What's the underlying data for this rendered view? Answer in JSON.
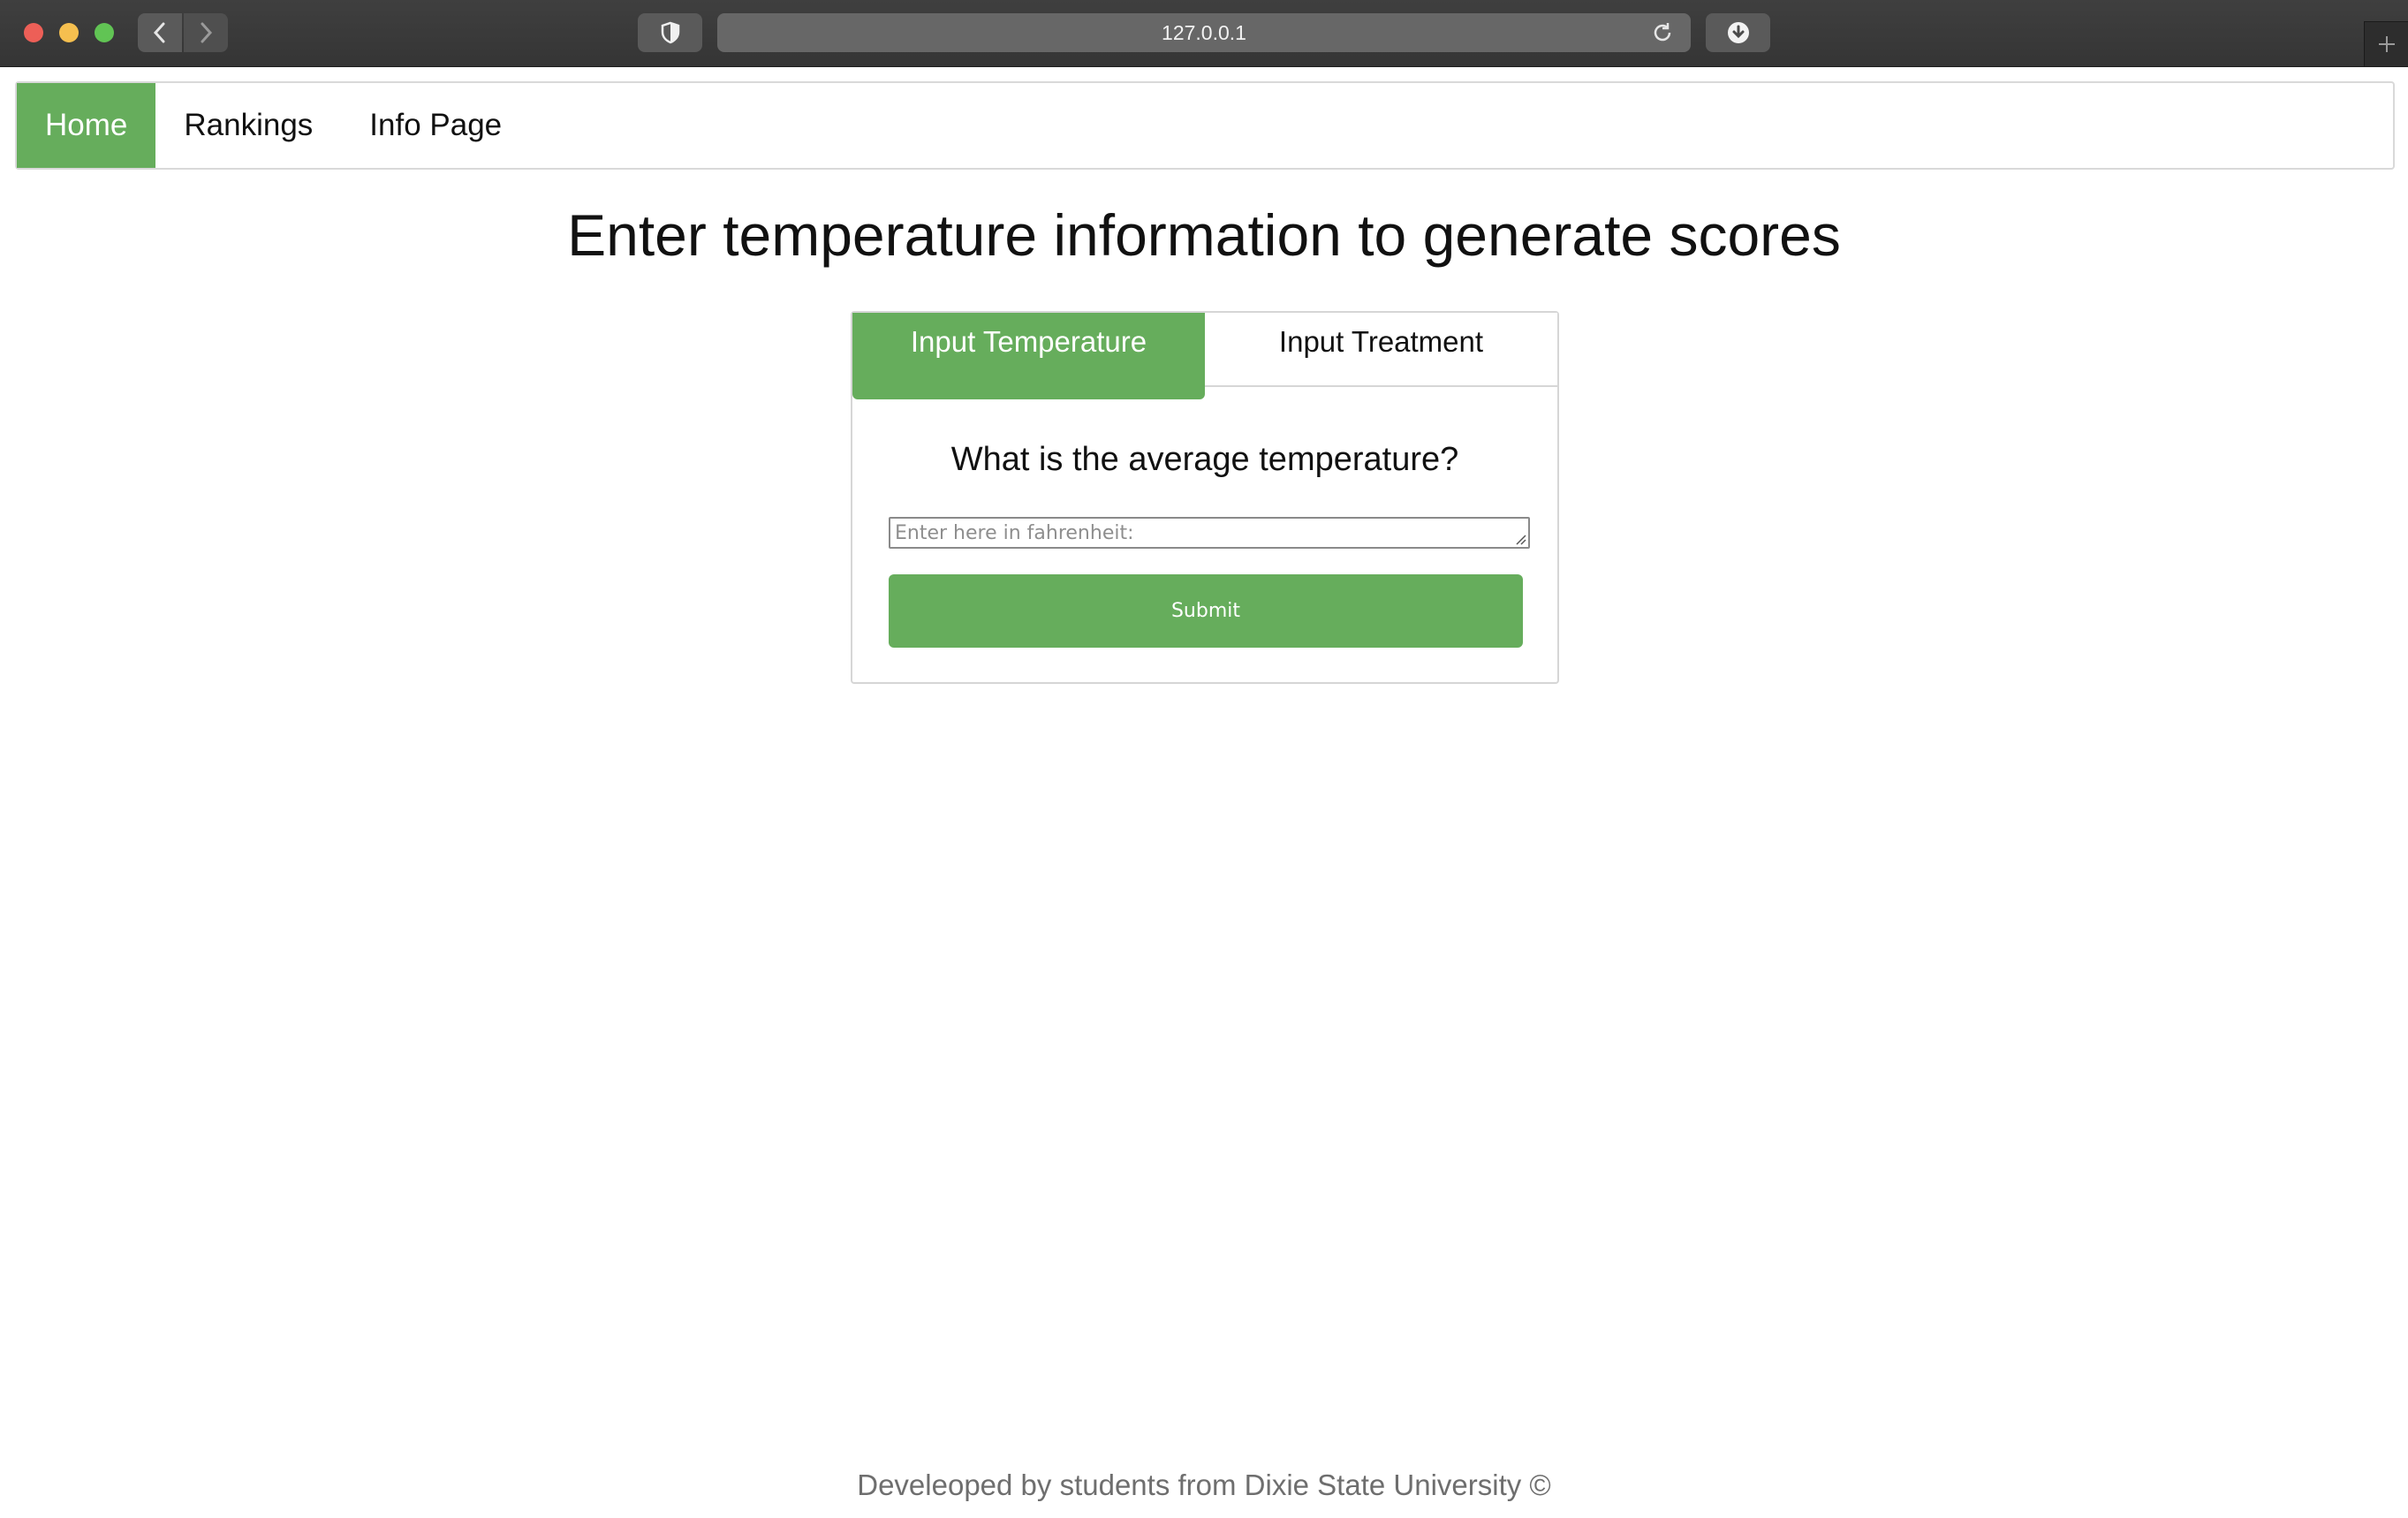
{
  "browser": {
    "url": "127.0.0.1",
    "icons": {
      "back": "chevron-left-icon",
      "forward": "chevron-right-icon",
      "shield": "shield-icon",
      "reload": "reload-icon",
      "download": "download-icon",
      "new_tab": "plus-icon"
    }
  },
  "nav": {
    "items": [
      {
        "label": "Home",
        "active": true
      },
      {
        "label": "Rankings",
        "active": false
      },
      {
        "label": "Info Page",
        "active": false
      }
    ]
  },
  "main": {
    "heading": "Enter temperature information to generate scores",
    "tabs": [
      {
        "label": "Input Temperature",
        "active": true
      },
      {
        "label": "Input Treatment",
        "active": false
      }
    ],
    "question": "What is the average temperature?",
    "input_placeholder": "Enter here in fahrenheit:",
    "input_value": "",
    "submit_label": "Submit"
  },
  "footer": {
    "text": "Develeoped by students from Dixie State University ©"
  },
  "colors": {
    "accent_green": "#66ad5c",
    "chrome_dark": "#3f3f3f"
  }
}
